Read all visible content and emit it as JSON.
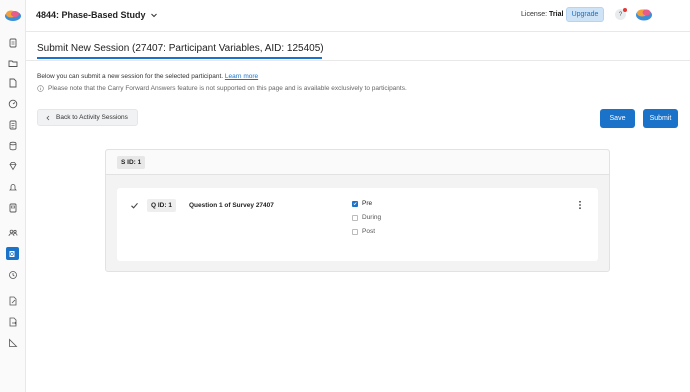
{
  "header": {
    "study_title": "4844: Phase-Based Study",
    "license_label": "License:",
    "license_value": "Trial",
    "upgrade_label": "Upgrade",
    "help_label": "?"
  },
  "page": {
    "title": "Submit New Session (27407: Participant Variables, AID: 125405)",
    "intro_text": "Below you can submit a new session for the selected participant.",
    "learn_more": "Learn more",
    "note": "Please note that the Carry Forward Answers feature is not supported on this page and is available exclusively to participants."
  },
  "actions": {
    "back_label": "Back to Activity Sessions",
    "save_label": "Save",
    "submit_label": "Submit"
  },
  "session": {
    "sid_label": "S ID: 1",
    "question": {
      "qid_label": "Q ID: 1",
      "text": "Question 1 of Survey 27407",
      "options": [
        {
          "label": "Pre",
          "checked": true
        },
        {
          "label": "During",
          "checked": false
        },
        {
          "label": "Post",
          "checked": false
        }
      ]
    }
  },
  "colors": {
    "accent": "#1a72c9",
    "upgrade_bg": "#cfe3f7"
  },
  "sidebar": {
    "icons": [
      "document-icon",
      "folder-icon",
      "file-icon",
      "dashboard-icon",
      "file-list-icon",
      "database-icon",
      "diamond-icon",
      "bell-icon",
      "form-icon",
      "users-icon",
      "outlook-icon",
      "history-icon",
      "edit-file-icon",
      "export-icon",
      "ruler-icon"
    ]
  }
}
